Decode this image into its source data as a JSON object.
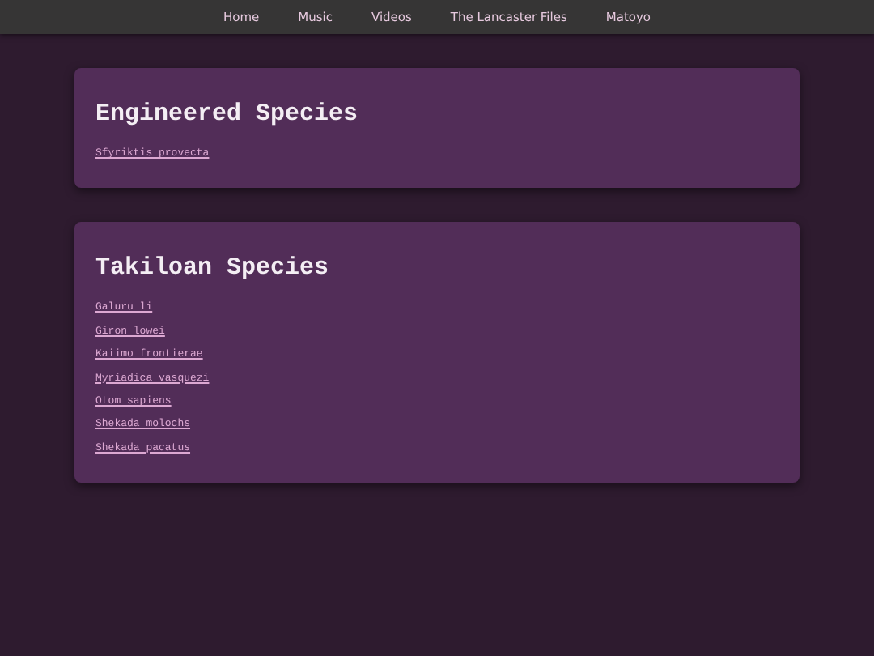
{
  "nav": [
    {
      "label": "Home"
    },
    {
      "label": "Music"
    },
    {
      "label": "Videos"
    },
    {
      "label": "The Lancaster Files"
    },
    {
      "label": "Matoyo"
    }
  ],
  "sections": [
    {
      "title": "Engineered Species",
      "links": [
        "Sfyriktis provecta"
      ]
    },
    {
      "title": "Takiloan Species",
      "links": [
        "Galuru li",
        "Giron lowei",
        "Kaiimo frontierae",
        "Myriadica vasquezi",
        "Otom sapiens",
        "Shekada molochs",
        "Shekada pacatus"
      ]
    }
  ]
}
